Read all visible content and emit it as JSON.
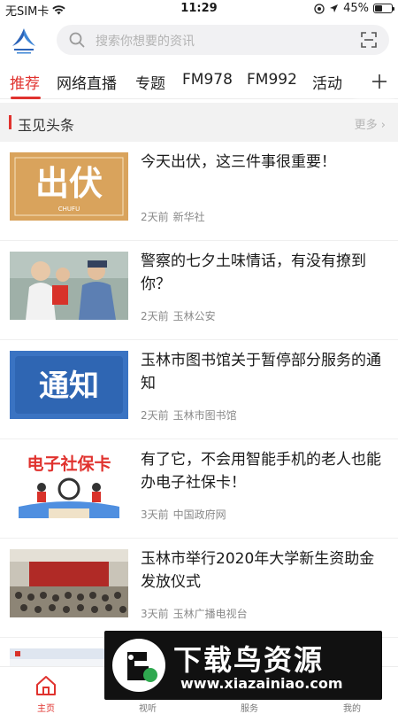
{
  "status": {
    "carrier": "无SIM卡",
    "time": "11:29",
    "battery": "45%",
    "battery_level": 0.45
  },
  "search": {
    "placeholder": "搜索你想要的资讯"
  },
  "tabs": [
    {
      "label": "推荐",
      "active": true
    },
    {
      "label": "网络直播"
    },
    {
      "label": "专题"
    },
    {
      "label": "FM978"
    },
    {
      "label": "FM992"
    },
    {
      "label": "活动"
    }
  ],
  "section": {
    "title": "玉见头条",
    "more": "更多"
  },
  "news": [
    {
      "title": "今天出伏，这三件事很重要！",
      "time": "2天前",
      "source": "新华社",
      "thumb_text": "出伏",
      "thumb_sub": "CHUFU"
    },
    {
      "title": "警察的七夕土味情话，有没有撩到你？",
      "time": "2天前",
      "source": "玉林公安"
    },
    {
      "title": "玉林市图书馆关于暂停部分服务的通知",
      "time": "2天前",
      "source": "玉林市图书馆",
      "thumb_text": "通知"
    },
    {
      "title": "有了它，不会用智能手机的老人也能办电子社保卡！",
      "time": "3天前",
      "source": "中国政府网",
      "thumb_text": "电子社保卡"
    },
    {
      "title": "玉林市举行2020年大学新生资助金发放仪式",
      "time": "3天前",
      "source": "玉林广播电视台"
    }
  ],
  "tabbar": [
    {
      "label": "主页",
      "icon": "home-icon",
      "active": true
    },
    {
      "label": "视听",
      "icon": "play-icon"
    },
    {
      "label": "服务",
      "icon": "service-icon"
    },
    {
      "label": "我的",
      "icon": "user-icon"
    }
  ],
  "watermark": {
    "brand": "下载鸟资源",
    "url": "www.xiazainiao.com"
  },
  "colors": {
    "accent": "#e0322e",
    "tab_text": "#222222",
    "meta": "#8a8a8a"
  }
}
